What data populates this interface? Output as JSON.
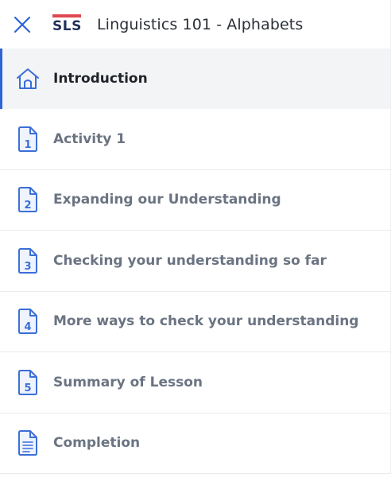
{
  "header": {
    "close_icon": "close-icon",
    "logo_text": "SLS",
    "title": "Linguistics 101 - Alphabets"
  },
  "nav": {
    "items": [
      {
        "label": "Introduction",
        "icon": "home-icon",
        "number": "",
        "active": true
      },
      {
        "label": "Activity 1",
        "icon": "document-number-icon",
        "number": "1",
        "active": false
      },
      {
        "label": "Expanding our Understanding",
        "icon": "document-number-icon",
        "number": "2",
        "active": false
      },
      {
        "label": "Checking your understanding so far",
        "icon": "document-number-icon",
        "number": "3",
        "active": false
      },
      {
        "label": "More ways to check your understanding",
        "icon": "document-number-icon",
        "number": "4",
        "active": false
      },
      {
        "label": "Summary of Lesson",
        "icon": "document-number-icon",
        "number": "5",
        "active": false
      },
      {
        "label": "Completion",
        "icon": "document-lines-icon",
        "number": "",
        "active": false
      }
    ]
  },
  "colors": {
    "accent": "#2f63d6",
    "icon_blue": "#3b6fd8",
    "logo_red": "#e0474f",
    "logo_navy": "#22305a",
    "active_bg": "#f3f4f6",
    "label_gray": "#6b7482"
  }
}
